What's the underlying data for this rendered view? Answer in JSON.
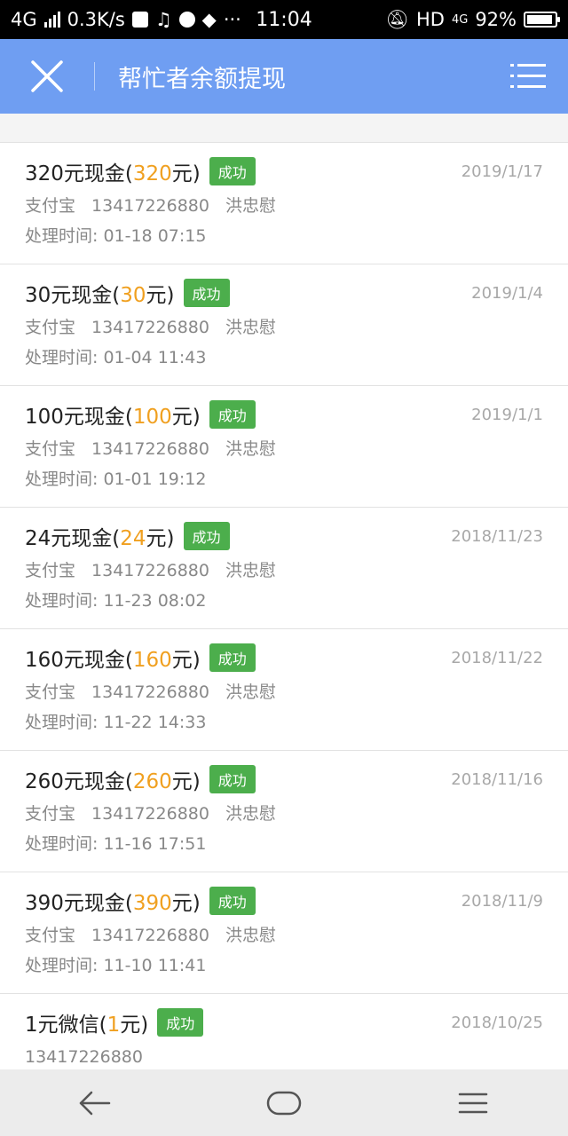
{
  "status": {
    "network": "4G",
    "speed": "0.3K/s",
    "time": "11:04",
    "hd": "HD",
    "net_small": "4G",
    "battery": "92%",
    "battery_level": 0.92
  },
  "header": {
    "title": "帮忙者余额提现"
  },
  "records": [
    {
      "name_pre": "320元现金(",
      "amount": "320",
      "name_post": "元)",
      "status": "成功",
      "date": "2019/1/17",
      "method": "支付宝",
      "account": "13417226880",
      "holder": "洪忠慰",
      "processed": "处理时间: 01-18 07:15"
    },
    {
      "name_pre": "30元现金(",
      "amount": "30",
      "name_post": "元)",
      "status": "成功",
      "date": "2019/1/4",
      "method": "支付宝",
      "account": "13417226880",
      "holder": "洪忠慰",
      "processed": "处理时间: 01-04 11:43"
    },
    {
      "name_pre": "100元现金(",
      "amount": "100",
      "name_post": "元)",
      "status": "成功",
      "date": "2019/1/1",
      "method": "支付宝",
      "account": "13417226880",
      "holder": "洪忠慰",
      "processed": "处理时间: 01-01 19:12"
    },
    {
      "name_pre": "24元现金(",
      "amount": "24",
      "name_post": "元)",
      "status": "成功",
      "date": "2018/11/23",
      "method": "支付宝",
      "account": "13417226880",
      "holder": "洪忠慰",
      "processed": "处理时间: 11-23 08:02"
    },
    {
      "name_pre": "160元现金(",
      "amount": "160",
      "name_post": "元)",
      "status": "成功",
      "date": "2018/11/22",
      "method": "支付宝",
      "account": "13417226880",
      "holder": "洪忠慰",
      "processed": "处理时间: 11-22 14:33"
    },
    {
      "name_pre": "260元现金(",
      "amount": "260",
      "name_post": "元)",
      "status": "成功",
      "date": "2018/11/16",
      "method": "支付宝",
      "account": "13417226880",
      "holder": "洪忠慰",
      "processed": "处理时间: 11-16 17:51"
    },
    {
      "name_pre": "390元现金(",
      "amount": "390",
      "name_post": "元)",
      "status": "成功",
      "date": "2018/11/9",
      "method": "支付宝",
      "account": "13417226880",
      "holder": "洪忠慰",
      "processed": "处理时间: 11-10 11:41"
    }
  ],
  "last_record": {
    "name_pre": "1元微信(",
    "amount": "1",
    "name_post": "元)",
    "status": "成功",
    "date": "2018/10/25",
    "account": "13417226880"
  },
  "colors": {
    "header_bg": "#6f9ef2",
    "amount": "#f0a020",
    "badge": "#4cae4c"
  }
}
